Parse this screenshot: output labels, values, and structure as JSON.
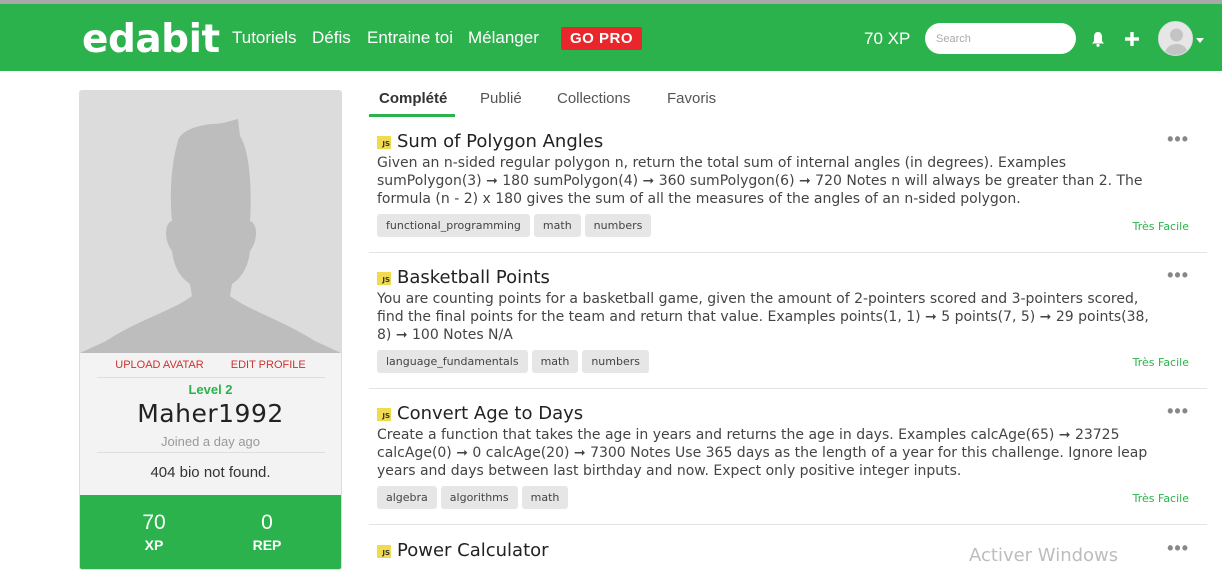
{
  "navbar": {
    "logo": "edabit",
    "links": [
      "Tutoriels",
      "Défis",
      "Entraine toi",
      "Mélanger"
    ],
    "gopro": "GO PRO",
    "xp": "70 XP",
    "search_placeholder": "Search",
    "bell_icon": "bell-icon",
    "plus_icon": "plus-icon",
    "colors": {
      "bg": "#2cb24c",
      "gopro": "#e9262c"
    }
  },
  "profile": {
    "upload_avatar": "UPLOAD AVATAR",
    "edit_profile": "EDIT PROFILE",
    "level": "Level 2",
    "username": "Maher1992",
    "joined": "Joined a day ago",
    "bio": "404 bio not found.",
    "xp_value": "70",
    "xp_label": "XP",
    "rep_value": "0",
    "rep_label": "REP"
  },
  "tabs": [
    "Complété",
    "Publié",
    "Collections",
    "Favoris"
  ],
  "challenges": [
    {
      "lang": "JS",
      "title": "Sum of Polygon Angles",
      "description": "Given an n-sided regular polygon n, return the total sum of internal angles (in degrees). Examples sumPolygon(3) ➞ 180 sumPolygon(4) ➞ 360 sumPolygon(6) ➞ 720 Notes n will always be greater than 2. The formula (n - 2) x 180 gives the sum of all the measures of the angles of an n-sided polygon.",
      "tags": [
        "functional_programming",
        "math",
        "numbers"
      ],
      "difficulty": "Très Facile"
    },
    {
      "lang": "JS",
      "title": "Basketball Points",
      "description": "You are counting points for a basketball game, given the amount of 2-pointers scored and 3-pointers scored, find the final points for the team and return that value. Examples points(1, 1) ➞ 5 points(7, 5) ➞ 29 points(38, 8) ➞ 100 Notes N/A",
      "tags": [
        "language_fundamentals",
        "math",
        "numbers"
      ],
      "difficulty": "Très Facile"
    },
    {
      "lang": "JS",
      "title": "Convert Age to Days",
      "description": "Create a function that takes the age in years and returns the age in days. Examples calcAge(65) ➞ 23725 calcAge(0) ➞ 0 calcAge(20) ➞ 7300 Notes Use 365 days as the length of a year for this challenge. Ignore leap years and days between last birthday and now. Expect only positive integer inputs.",
      "tags": [
        "algebra",
        "algorithms",
        "math"
      ],
      "difficulty": "Très Facile"
    },
    {
      "lang": "JS",
      "title": "Power Calculator"
    }
  ],
  "more_icon": "ellipsis-icon",
  "watermark": "Activer Windows"
}
